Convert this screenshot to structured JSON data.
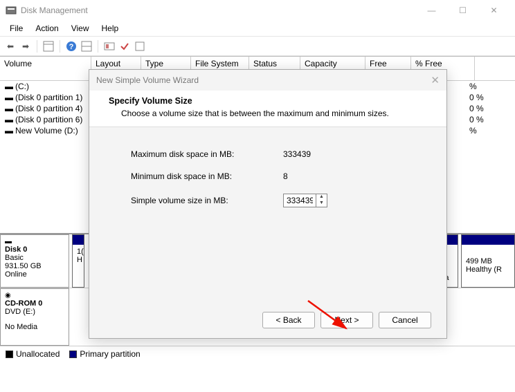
{
  "titlebar": {
    "title": "Disk Management"
  },
  "menu": {
    "file": "File",
    "action": "Action",
    "view": "View",
    "help": "Help"
  },
  "columns": {
    "volume": "Volume",
    "layout": "Layout",
    "type": "Type",
    "fs": "File System",
    "status": "Status",
    "capacity": "Capacity",
    "free": "Free Spa...",
    "pct": "% Free"
  },
  "volumes": [
    {
      "name": "(C:)",
      "pct_tail": "%"
    },
    {
      "name": "(Disk 0 partition 1)",
      "pct_tail": "0 %"
    },
    {
      "name": "(Disk 0 partition 4)",
      "pct_tail": "0 %"
    },
    {
      "name": "(Disk 0 partition 6)",
      "pct_tail": "0 %"
    },
    {
      "name": "New Volume (D:)",
      "pct_tail": "%"
    }
  ],
  "disk0": {
    "title": "Disk 0",
    "type": "Basic",
    "size": "931.50 GB",
    "status": "Online",
    "bar1_text": "1(",
    "bar1_text2": "H",
    "bar2_text1": ":)",
    "bar2_text2": "ta Pa",
    "bar3_text1": "499 MB",
    "bar3_text2": "Healthy (R"
  },
  "cdrom": {
    "title": "CD-ROM 0",
    "sub": "DVD (E:)",
    "status": "No Media"
  },
  "legend": {
    "unalloc": "Unallocated",
    "primary": "Primary partition"
  },
  "wizard": {
    "title": "New Simple Volume Wizard",
    "heading": "Specify Volume Size",
    "sub": "Choose a volume size that is between the maximum and minimum sizes.",
    "max_label": "Maximum disk space in MB:",
    "max_val": "333439",
    "min_label": "Minimum disk space in MB:",
    "min_val": "8",
    "size_label": "Simple volume size in MB:",
    "size_val": "333439",
    "back": "< Back",
    "next": "Next >",
    "cancel": "Cancel"
  }
}
